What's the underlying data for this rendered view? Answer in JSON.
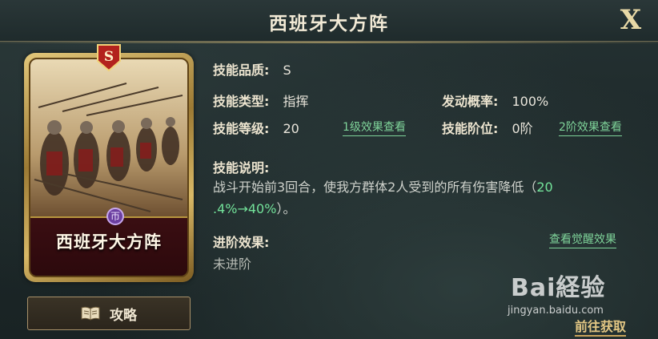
{
  "header": {
    "title": "西班牙大方阵",
    "close_label": "X"
  },
  "card": {
    "badge": "S",
    "name": "西班牙大方阵",
    "crest": "帀"
  },
  "guide_button": {
    "label": "攻略",
    "icon": "book-icon"
  },
  "info": {
    "quality_label": "技能品质:",
    "quality_value": "S",
    "type_label": "技能类型:",
    "type_value": "指挥",
    "rate_label": "发动概率:",
    "rate_value": "100%",
    "level_label": "技能等级:",
    "level_value": "20",
    "level_link": "1级效果查看",
    "stage_label": "技能阶位:",
    "stage_value": "0阶",
    "stage_link": "2阶效果查看",
    "desc_label": "技能说明:",
    "desc_text_1": "战斗开始前3回合，使我方群体2人受到的所有伤害降低（",
    "desc_highlight_a": "20",
    "desc_highlight_b": ".4%→40%",
    "desc_text_2": "）。",
    "advance_label": "进阶效果:",
    "advance_link": "查看觉醒效果",
    "advance_value": "未进阶"
  },
  "acquire_label": "前往获取",
  "watermark": {
    "logo": "Bai経验",
    "url": "jingyan.baidu.com"
  },
  "colors": {
    "accent_green": "#73e39a",
    "gold": "#e3c784",
    "card_red": "#3a0e12"
  }
}
